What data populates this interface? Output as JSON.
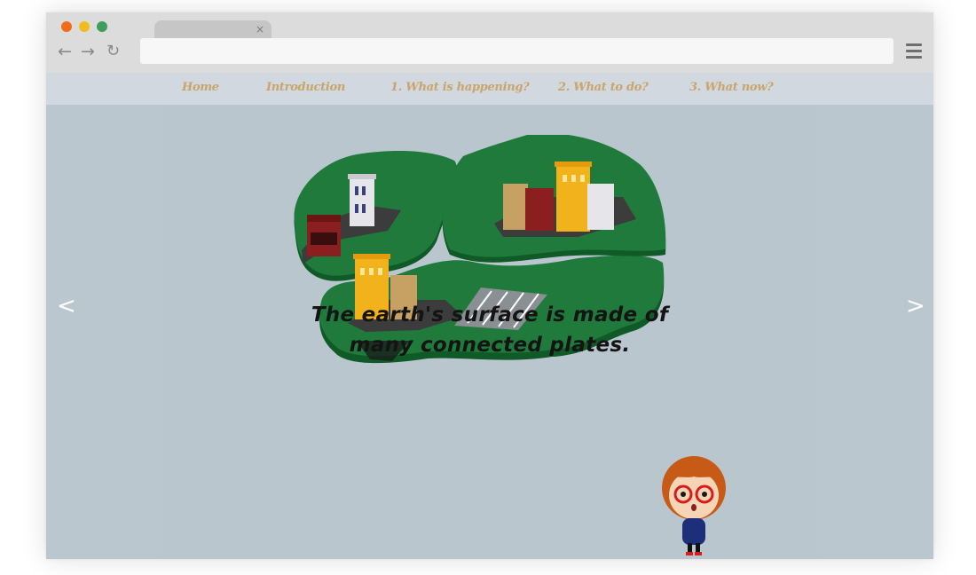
{
  "browser": {
    "tab": {
      "close_icon": "×"
    },
    "nav": {
      "back_icon": "←",
      "forward_icon": "→",
      "reload_icon": "↻"
    },
    "url": ""
  },
  "site_nav": {
    "items": [
      {
        "label": "Home"
      },
      {
        "label": "Introduction"
      },
      {
        "label": "1. What is happening?"
      },
      {
        "label": "2. What to do?"
      },
      {
        "label": "3. What now?"
      }
    ]
  },
  "slide": {
    "prev_label": "<",
    "next_label": ">",
    "caption_line1": "The earth's surface is made of",
    "caption_line2": "many connected plates."
  },
  "colors": {
    "nav_link": "#c9a56a",
    "land": "#1e7a3a",
    "land_edge": "#0f5a26",
    "water": "#8fb0bb",
    "background": "#b9c6ce"
  }
}
